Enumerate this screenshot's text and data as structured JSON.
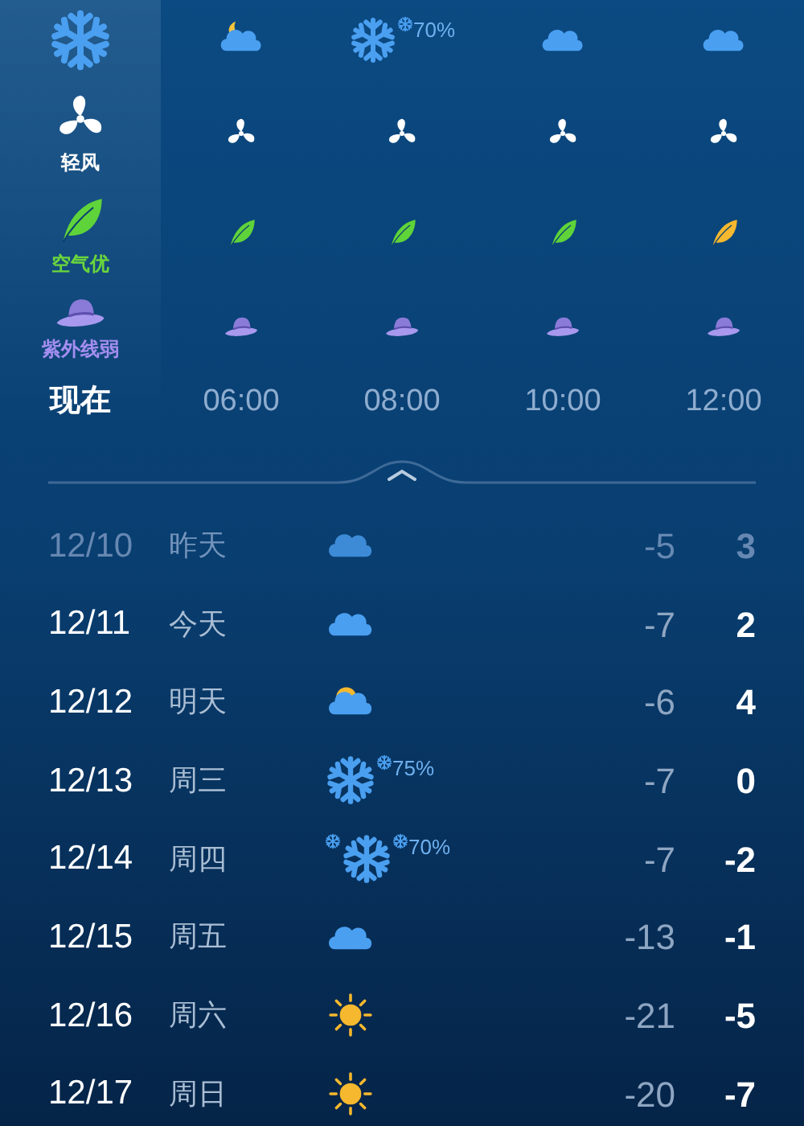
{
  "hourly": [
    {
      "time": "现在",
      "selected": true,
      "kind": "snow",
      "wind_label": "轻风",
      "color": "#5fd33a",
      "air_label": "空气优",
      "uv_label": "紫外线弱"
    },
    {
      "time": "06:00",
      "selected": false,
      "kind": "moon_cloud",
      "color": "#5fd33a"
    },
    {
      "time": "08:00",
      "selected": false,
      "kind": "snow",
      "precip": "70%",
      "color": "#5fd33a"
    },
    {
      "time": "10:00",
      "selected": false,
      "kind": "cloud",
      "color": "#5fd33a"
    },
    {
      "time": "12:00",
      "selected": false,
      "kind": "cloud",
      "color": "#f5b82e"
    }
  ],
  "daily": [
    {
      "date": "12/10",
      "day": "昨天",
      "past": true,
      "kind": "cloud",
      "low": "-5",
      "high": "3"
    },
    {
      "date": "12/11",
      "day": "今天",
      "past": false,
      "kind": "cloud",
      "low": "-7",
      "high": "2"
    },
    {
      "date": "12/12",
      "day": "明天",
      "past": false,
      "kind": "sun_cloud",
      "low": "-6",
      "high": "4"
    },
    {
      "date": "12/13",
      "day": "周三",
      "past": false,
      "kind": "snow",
      "precip": "75%",
      "low": "-7",
      "high": "0"
    },
    {
      "date": "12/14",
      "day": "周四",
      "past": false,
      "kind": "heavy_snow",
      "precip": "70%",
      "low": "-7",
      "high": "-2"
    },
    {
      "date": "12/15",
      "day": "周五",
      "past": false,
      "kind": "cloud",
      "low": "-13",
      "high": "-1"
    },
    {
      "date": "12/16",
      "day": "周六",
      "past": false,
      "kind": "sun",
      "low": "-21",
      "high": "-5"
    },
    {
      "date": "12/17",
      "day": "周日",
      "past": false,
      "kind": "sun",
      "low": "-20",
      "high": "-7"
    }
  ]
}
